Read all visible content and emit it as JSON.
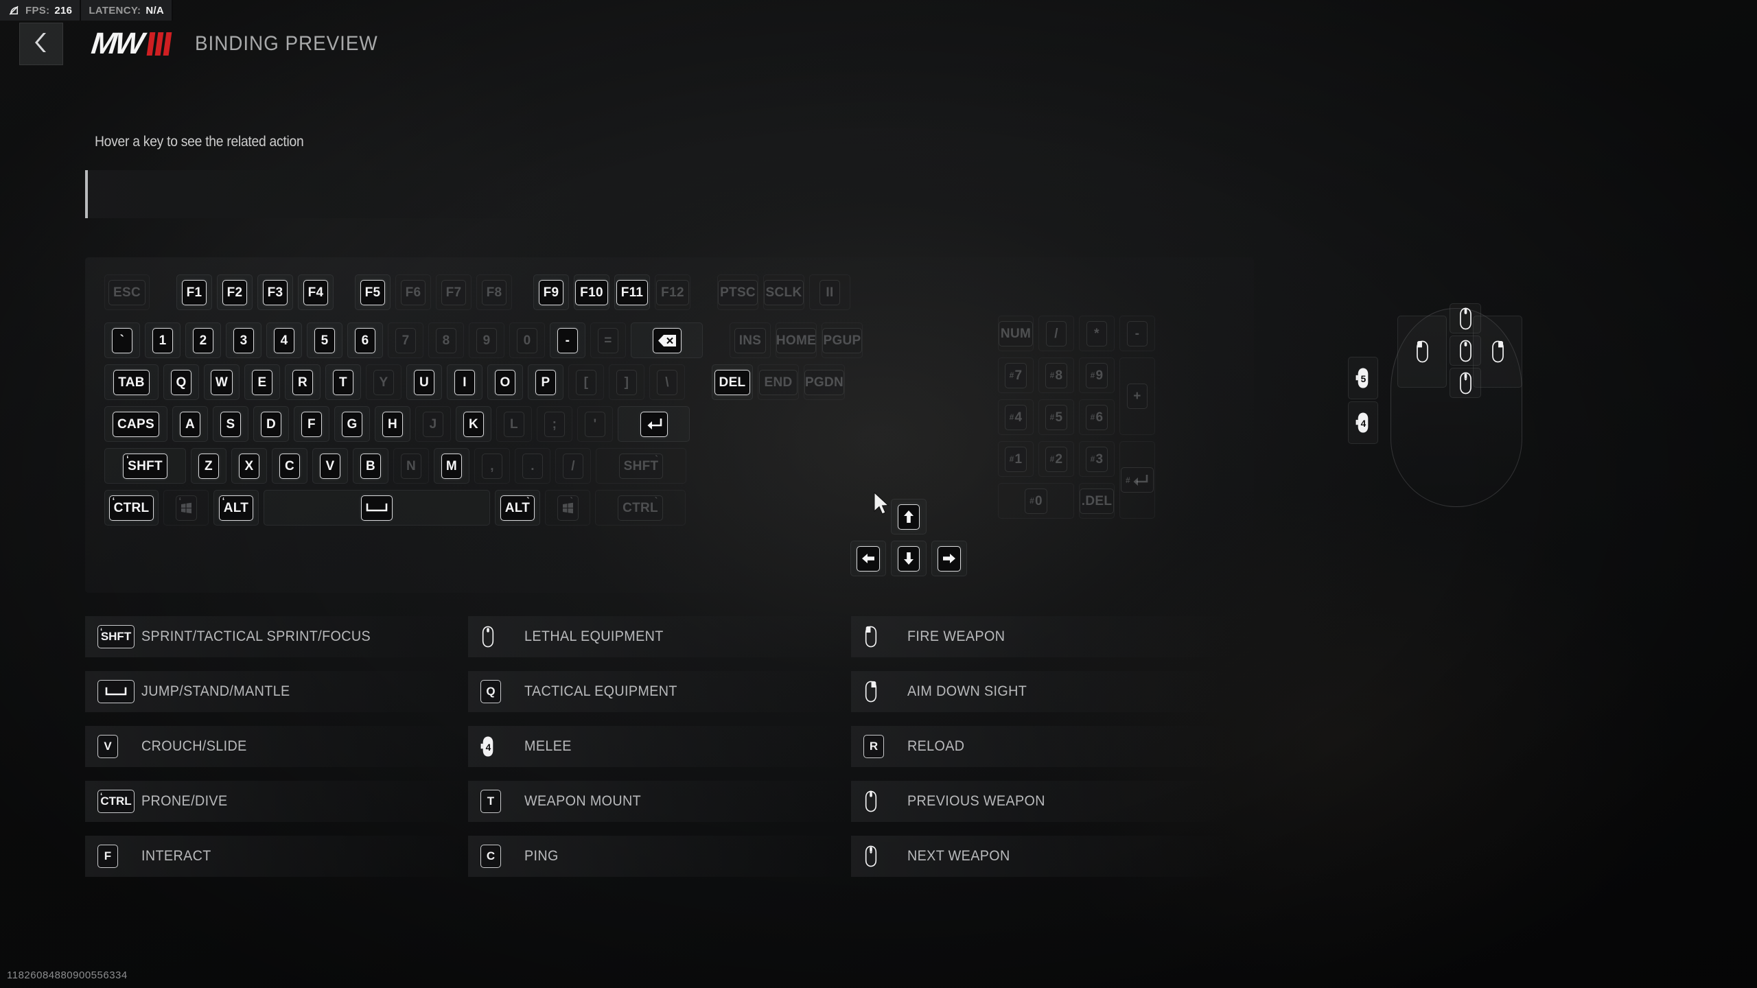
{
  "status": {
    "net_icon": "network-disconnected-icon",
    "fps_label": "FPS:",
    "fps_value": "216",
    "latency_label": "LATENCY:",
    "latency_value": "N/A"
  },
  "header": {
    "back_icon": "chevron-left-icon",
    "logo_text": "MW",
    "logo_numeral": "III",
    "title": "BINDING PREVIEW",
    "accent_color": "#cf1f22"
  },
  "prompt": {
    "text": "Hover a key to see the related action",
    "action_text": ""
  },
  "keyboard": {
    "rows": [
      {
        "name": "function-row",
        "keys": [
          {
            "id": "esc",
            "label": "ESC",
            "w": "w-125",
            "bound": false
          },
          {
            "type": "gap",
            "w": "gap-md"
          },
          {
            "id": "f1",
            "label": "F1",
            "w": "w-1",
            "bound": true
          },
          {
            "id": "f2",
            "label": "F2",
            "w": "w-1",
            "bound": true
          },
          {
            "id": "f3",
            "label": "F3",
            "w": "w-1",
            "bound": true
          },
          {
            "id": "f4",
            "label": "F4",
            "w": "w-1",
            "bound": true
          },
          {
            "type": "gap",
            "w": "gap-sm"
          },
          {
            "id": "f5",
            "label": "F5",
            "w": "w-1",
            "bound": true
          },
          {
            "id": "f6",
            "label": "F6",
            "w": "w-1",
            "bound": false
          },
          {
            "id": "f7",
            "label": "F7",
            "w": "w-1",
            "bound": false
          },
          {
            "id": "f8",
            "label": "F8",
            "w": "w-1",
            "bound": false
          },
          {
            "type": "gap",
            "w": "gap-sm"
          },
          {
            "id": "f9",
            "label": "F9",
            "w": "w-1",
            "bound": true
          },
          {
            "id": "f10",
            "label": "F10",
            "w": "w-1",
            "bound": true
          },
          {
            "id": "f11",
            "label": "F11",
            "w": "w-1",
            "bound": true
          },
          {
            "id": "f12",
            "label": "F12",
            "w": "w-1",
            "bound": false
          },
          {
            "type": "gap",
            "w": "gap-md"
          },
          {
            "id": "ptsc",
            "label": "PTSC",
            "w": "w-115",
            "bound": false
          },
          {
            "id": "sclk",
            "label": "SCLK",
            "w": "w-115",
            "bound": false
          },
          {
            "id": "pause",
            "label": "II",
            "w": "w-115",
            "bound": false
          }
        ]
      },
      {
        "name": "number-row",
        "keys": [
          {
            "id": "grave",
            "label": "`",
            "w": "w-1",
            "bound": true
          },
          {
            "id": "1",
            "label": "1",
            "w": "w-1",
            "bound": true
          },
          {
            "id": "2",
            "label": "2",
            "w": "w-1",
            "bound": true
          },
          {
            "id": "3",
            "label": "3",
            "w": "w-1",
            "bound": true
          },
          {
            "id": "4",
            "label": "4",
            "w": "w-1",
            "bound": true
          },
          {
            "id": "5",
            "label": "5",
            "w": "w-1",
            "bound": true
          },
          {
            "id": "6",
            "label": "6",
            "w": "w-1",
            "bound": true
          },
          {
            "id": "7",
            "label": "7",
            "w": "w-1",
            "bound": false
          },
          {
            "id": "8",
            "label": "8",
            "w": "w-1",
            "bound": false
          },
          {
            "id": "9",
            "label": "9",
            "w": "w-1",
            "bound": false
          },
          {
            "id": "0",
            "label": "0",
            "w": "w-1",
            "bound": false
          },
          {
            "id": "minus",
            "label": "-",
            "w": "w-1",
            "bound": true
          },
          {
            "id": "equal",
            "label": "=",
            "w": "w-1",
            "bound": false
          },
          {
            "id": "backspace",
            "label": "backspace-icon",
            "icon": "backspace",
            "w": "w-2",
            "bound": true
          },
          {
            "type": "gap",
            "w": "gap-md"
          },
          {
            "id": "ins",
            "label": "INS",
            "w": "w-115",
            "bound": false
          },
          {
            "id": "home",
            "label": "HOME",
            "w": "w-115",
            "bound": false
          },
          {
            "id": "pgup",
            "label": "PGUP",
            "w": "w-115",
            "bound": false
          }
        ]
      },
      {
        "name": "qwerty-row",
        "keys": [
          {
            "id": "tab",
            "label": "TAB",
            "w": "w-15",
            "bound": true
          },
          {
            "id": "q",
            "label": "Q",
            "w": "w-1",
            "bound": true
          },
          {
            "id": "w",
            "label": "W",
            "w": "w-1",
            "bound": true
          },
          {
            "id": "e",
            "label": "E",
            "w": "w-1",
            "bound": true
          },
          {
            "id": "r",
            "label": "R",
            "w": "w-1",
            "bound": true
          },
          {
            "id": "t",
            "label": "T",
            "w": "w-1",
            "bound": true
          },
          {
            "id": "y",
            "label": "Y",
            "w": "w-1",
            "bound": false
          },
          {
            "id": "u",
            "label": "U",
            "w": "w-1",
            "bound": true
          },
          {
            "id": "i",
            "label": "I",
            "w": "w-1",
            "bound": true
          },
          {
            "id": "o",
            "label": "O",
            "w": "w-1",
            "bound": true
          },
          {
            "id": "p",
            "label": "P",
            "w": "w-1",
            "bound": true
          },
          {
            "id": "lbracket",
            "label": "[",
            "w": "w-1",
            "bound": false
          },
          {
            "id": "rbracket",
            "label": "]",
            "w": "w-1",
            "bound": false
          },
          {
            "id": "backslash",
            "label": "\\",
            "w": "w-1",
            "bound": false
          },
          {
            "type": "gap",
            "w": "gap-md"
          },
          {
            "id": "del",
            "label": "DEL",
            "w": "w-115",
            "bound": true
          },
          {
            "id": "end",
            "label": "END",
            "w": "w-115",
            "bound": false
          },
          {
            "id": "pgdn",
            "label": "PGDN",
            "w": "w-115",
            "bound": false
          }
        ]
      },
      {
        "name": "home-row",
        "keys": [
          {
            "id": "caps",
            "label": "CAPS",
            "w": "w-175",
            "bound": true
          },
          {
            "id": "a",
            "label": "A",
            "w": "w-1",
            "bound": true
          },
          {
            "id": "s",
            "label": "S",
            "w": "w-1",
            "bound": true
          },
          {
            "id": "d",
            "label": "D",
            "w": "w-1",
            "bound": true
          },
          {
            "id": "f",
            "label": "F",
            "w": "w-1",
            "bound": true
          },
          {
            "id": "g",
            "label": "G",
            "w": "w-1",
            "bound": true
          },
          {
            "id": "h",
            "label": "H",
            "w": "w-1",
            "bound": true
          },
          {
            "id": "j",
            "label": "J",
            "w": "w-1",
            "bound": false
          },
          {
            "id": "k",
            "label": "K",
            "w": "w-1",
            "bound": true
          },
          {
            "id": "l",
            "label": "L",
            "w": "w-1",
            "bound": false
          },
          {
            "id": "semicolon",
            "label": ";",
            "w": "w-1",
            "bound": false
          },
          {
            "id": "quote",
            "label": "'",
            "w": "w-1",
            "bound": false
          },
          {
            "id": "enter",
            "label": "enter-icon",
            "icon": "enter",
            "w": "w-2",
            "bound": true
          }
        ]
      },
      {
        "name": "shift-row",
        "keys": [
          {
            "id": "lshift",
            "label": "SHFT",
            "tick": "left",
            "w": "w-225",
            "bound": true
          },
          {
            "id": "z",
            "label": "Z",
            "w": "w-1",
            "bound": true
          },
          {
            "id": "x",
            "label": "X",
            "w": "w-1",
            "bound": true
          },
          {
            "id": "c",
            "label": "C",
            "w": "w-1",
            "bound": true
          },
          {
            "id": "v",
            "label": "V",
            "w": "w-1",
            "bound": true
          },
          {
            "id": "b",
            "label": "B",
            "w": "w-1",
            "bound": true
          },
          {
            "id": "n",
            "label": "N",
            "w": "w-1",
            "bound": false
          },
          {
            "id": "m",
            "label": "M",
            "w": "w-1",
            "bound": true
          },
          {
            "id": "comma",
            "label": ",",
            "w": "w-1",
            "bound": false
          },
          {
            "id": "period",
            "label": ".",
            "w": "w-1",
            "bound": false
          },
          {
            "id": "slash",
            "label": "/",
            "w": "w-1",
            "bound": false
          },
          {
            "id": "rshift",
            "label": "SHFT",
            "tick": "right",
            "w": "w-25",
            "bound": false
          }
        ]
      },
      {
        "name": "bottom-row",
        "keys": [
          {
            "id": "lctrl",
            "label": "CTRL",
            "tick": "left",
            "w": "w-15",
            "bound": true
          },
          {
            "id": "lwin",
            "label": "win-icon",
            "icon": "win",
            "tick": "left",
            "w": "w-125",
            "bound": false
          },
          {
            "id": "lalt",
            "label": "ALT",
            "tick": "left",
            "w": "w-125",
            "bound": true
          },
          {
            "id": "space",
            "label": "space-icon",
            "icon": "space",
            "w": "w-6",
            "bound": true
          },
          {
            "id": "ralt",
            "label": "ALT",
            "tick": "right",
            "w": "w-125",
            "bound": true
          },
          {
            "id": "rwin",
            "label": "win-icon",
            "icon": "win",
            "tick": "right",
            "w": "w-125",
            "bound": false
          },
          {
            "id": "rctrl",
            "label": "CTRL",
            "tick": "right",
            "w": "w-25",
            "bound": false
          }
        ]
      }
    ],
    "arrows": [
      {
        "id": "arrow-up",
        "label": "arrow-up-icon",
        "icon": "up",
        "bound": true
      },
      {
        "id": "arrow-left",
        "label": "arrow-left-icon",
        "icon": "left",
        "bound": true
      },
      {
        "id": "arrow-down",
        "label": "arrow-down-icon",
        "icon": "down",
        "bound": true
      },
      {
        "id": "arrow-right",
        "label": "arrow-right-icon",
        "icon": "right",
        "bound": true
      }
    ],
    "numpad": [
      {
        "id": "numlock",
        "label": "NUM",
        "bound": false
      },
      {
        "id": "np-divide",
        "label": "/",
        "bound": false
      },
      {
        "id": "np-multiply",
        "label": "*",
        "bound": false
      },
      {
        "id": "np-minus",
        "label": "-",
        "bound": false
      },
      {
        "id": "np-7",
        "label": "7",
        "pre": "#",
        "bound": false
      },
      {
        "id": "np-8",
        "label": "8",
        "pre": "#",
        "bound": false
      },
      {
        "id": "np-9",
        "label": "9",
        "pre": "#",
        "bound": false
      },
      {
        "id": "np-plus",
        "label": "+",
        "bound": false
      },
      {
        "id": "np-4",
        "label": "4",
        "pre": "#",
        "bound": false
      },
      {
        "id": "np-5",
        "label": "5",
        "pre": "#",
        "bound": false
      },
      {
        "id": "np-6",
        "label": "6",
        "pre": "#",
        "bound": false
      },
      {
        "id": "np-1",
        "label": "1",
        "pre": "#",
        "bound": false
      },
      {
        "id": "np-2",
        "label": "2",
        "pre": "#",
        "bound": false
      },
      {
        "id": "np-3",
        "label": "3",
        "pre": "#",
        "bound": false
      },
      {
        "id": "np-enter",
        "label": "enter-icon",
        "pre": "#",
        "icon": "enter",
        "bound": false
      },
      {
        "id": "np-0",
        "label": "0",
        "pre": "#",
        "bound": false
      },
      {
        "id": "np-del",
        "label": ".DEL",
        "bound": false
      }
    ]
  },
  "mouse": {
    "buttons": [
      {
        "id": "mouse-left",
        "icon": "mouse-left-icon"
      },
      {
        "id": "mouse-right",
        "icon": "mouse-right-icon"
      },
      {
        "id": "mouse-scroll-up",
        "icon": "mouse-scroll-up-icon"
      },
      {
        "id": "mouse-middle",
        "icon": "mouse-middle-icon"
      },
      {
        "id": "mouse-scroll-down",
        "icon": "mouse-scroll-down-icon"
      },
      {
        "id": "mouse-button-5",
        "icon": "mouse-button-5-icon",
        "label": "5"
      },
      {
        "id": "mouse-button-4",
        "icon": "mouse-button-4-icon",
        "label": "4"
      }
    ]
  },
  "legend": {
    "columns": [
      {
        "name": "movement-column",
        "rows": [
          {
            "key": "SHFT",
            "icon": "key",
            "tick": "left",
            "wide": true,
            "action": "SPRINT/TACTICAL SPRINT/FOCUS"
          },
          {
            "key": "space-icon",
            "icon": "space",
            "wide": true,
            "action": "JUMP/STAND/MANTLE"
          },
          {
            "key": "V",
            "icon": "key",
            "action": "CROUCH/SLIDE"
          },
          {
            "key": "CTRL",
            "icon": "key",
            "tick": "left",
            "wide": true,
            "action": "PRONE/DIVE"
          },
          {
            "key": "F",
            "icon": "key",
            "action": "INTERACT"
          }
        ]
      },
      {
        "name": "equipment-column",
        "rows": [
          {
            "key": "mouse-middle-icon",
            "icon": "mouse-middle",
            "action": "LETHAL EQUIPMENT"
          },
          {
            "key": "Q",
            "icon": "key",
            "action": "TACTICAL EQUIPMENT"
          },
          {
            "key": "mouse-button-4-icon",
            "icon": "mouse4",
            "action": "MELEE"
          },
          {
            "key": "T",
            "icon": "key",
            "action": "WEAPON MOUNT"
          },
          {
            "key": "C",
            "icon": "key",
            "action": "PING"
          }
        ]
      },
      {
        "name": "weapon-column",
        "rows": [
          {
            "key": "mouse-left-icon",
            "icon": "mouse-left",
            "action": "FIRE WEAPON"
          },
          {
            "key": "mouse-right-icon",
            "icon": "mouse-right",
            "action": "AIM DOWN SIGHT"
          },
          {
            "key": "R",
            "icon": "key",
            "action": "RELOAD"
          },
          {
            "key": "mouse-scroll-up-icon",
            "icon": "mouse-scroll-up",
            "action": "PREVIOUS WEAPON"
          },
          {
            "key": "mouse-scroll-down-icon",
            "icon": "mouse-scroll-down",
            "action": "NEXT WEAPON"
          }
        ]
      }
    ]
  },
  "watermark": "11826084880900556334"
}
